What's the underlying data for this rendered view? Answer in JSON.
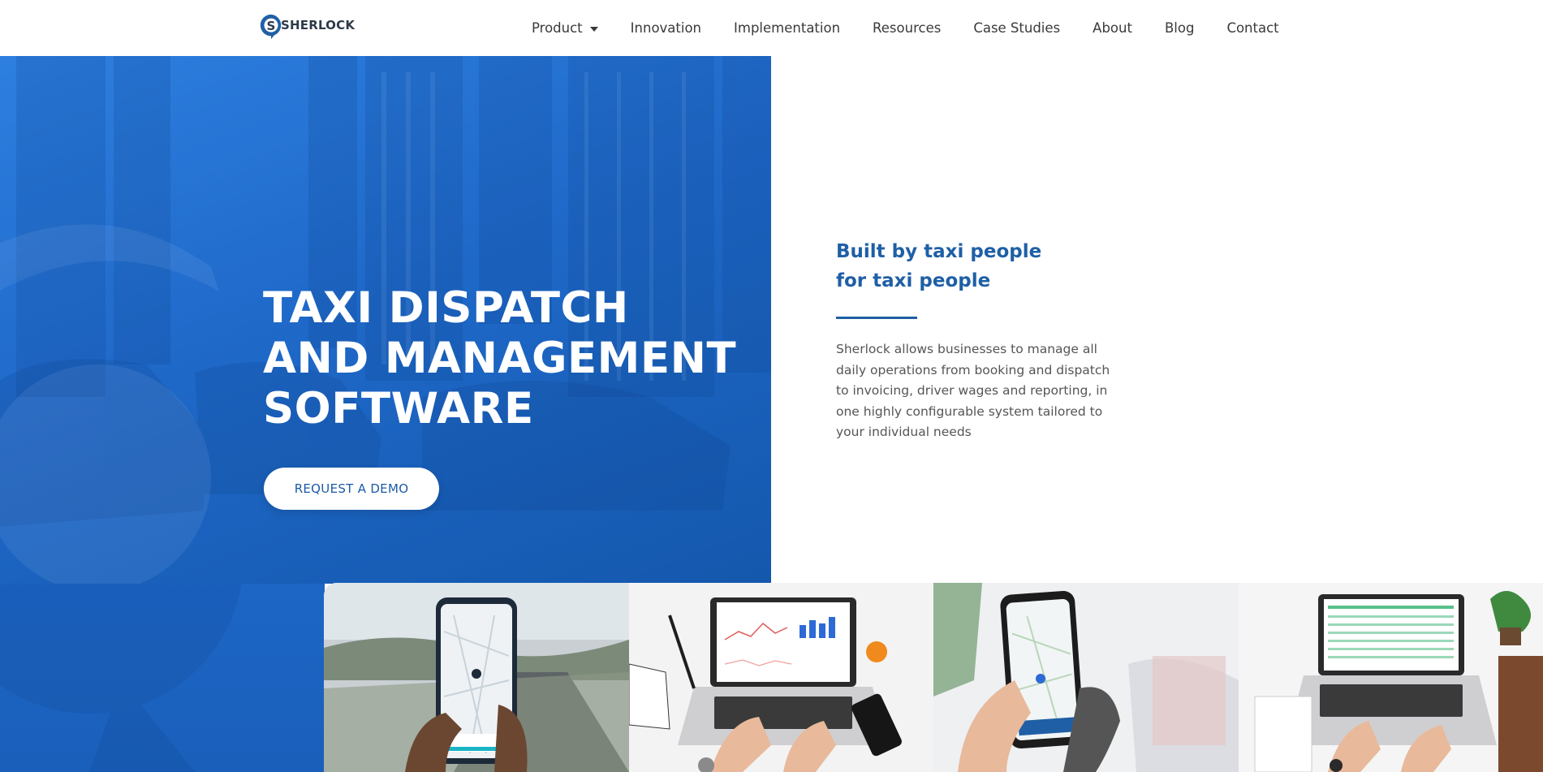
{
  "header": {
    "logo_text": "SHERLOCK",
    "nav": [
      {
        "label": "Product",
        "has_dropdown": true
      },
      {
        "label": "Innovation"
      },
      {
        "label": "Implementation"
      },
      {
        "label": "Resources"
      },
      {
        "label": "Case Studies"
      },
      {
        "label": "About"
      },
      {
        "label": "Blog"
      },
      {
        "label": "Contact"
      }
    ]
  },
  "hero": {
    "title_lines": [
      "TAXI DISPATCH",
      "AND MANAGEMENT",
      "SOFTWARE"
    ],
    "cta_label": "REQUEST A DEMO"
  },
  "intro": {
    "tagline_lines": [
      "Built by taxi people",
      "for taxi people"
    ],
    "description": "Sherlock allows businesses to manage all daily operations from booking and dispatch to invoicing, driver wages and reporting, in one highly configurable system tailored to your individual needs"
  },
  "photos": [
    {
      "icon": "phone-map-photo"
    },
    {
      "icon": "laptop-dashboard-photo"
    },
    {
      "icon": "phone-app-photo"
    },
    {
      "icon": "laptop-spreadsheet-photo"
    }
  ],
  "colors": {
    "brand_blue": "#1f5fa5",
    "hero_blue": "#1f69c9",
    "white": "#ffffff"
  }
}
